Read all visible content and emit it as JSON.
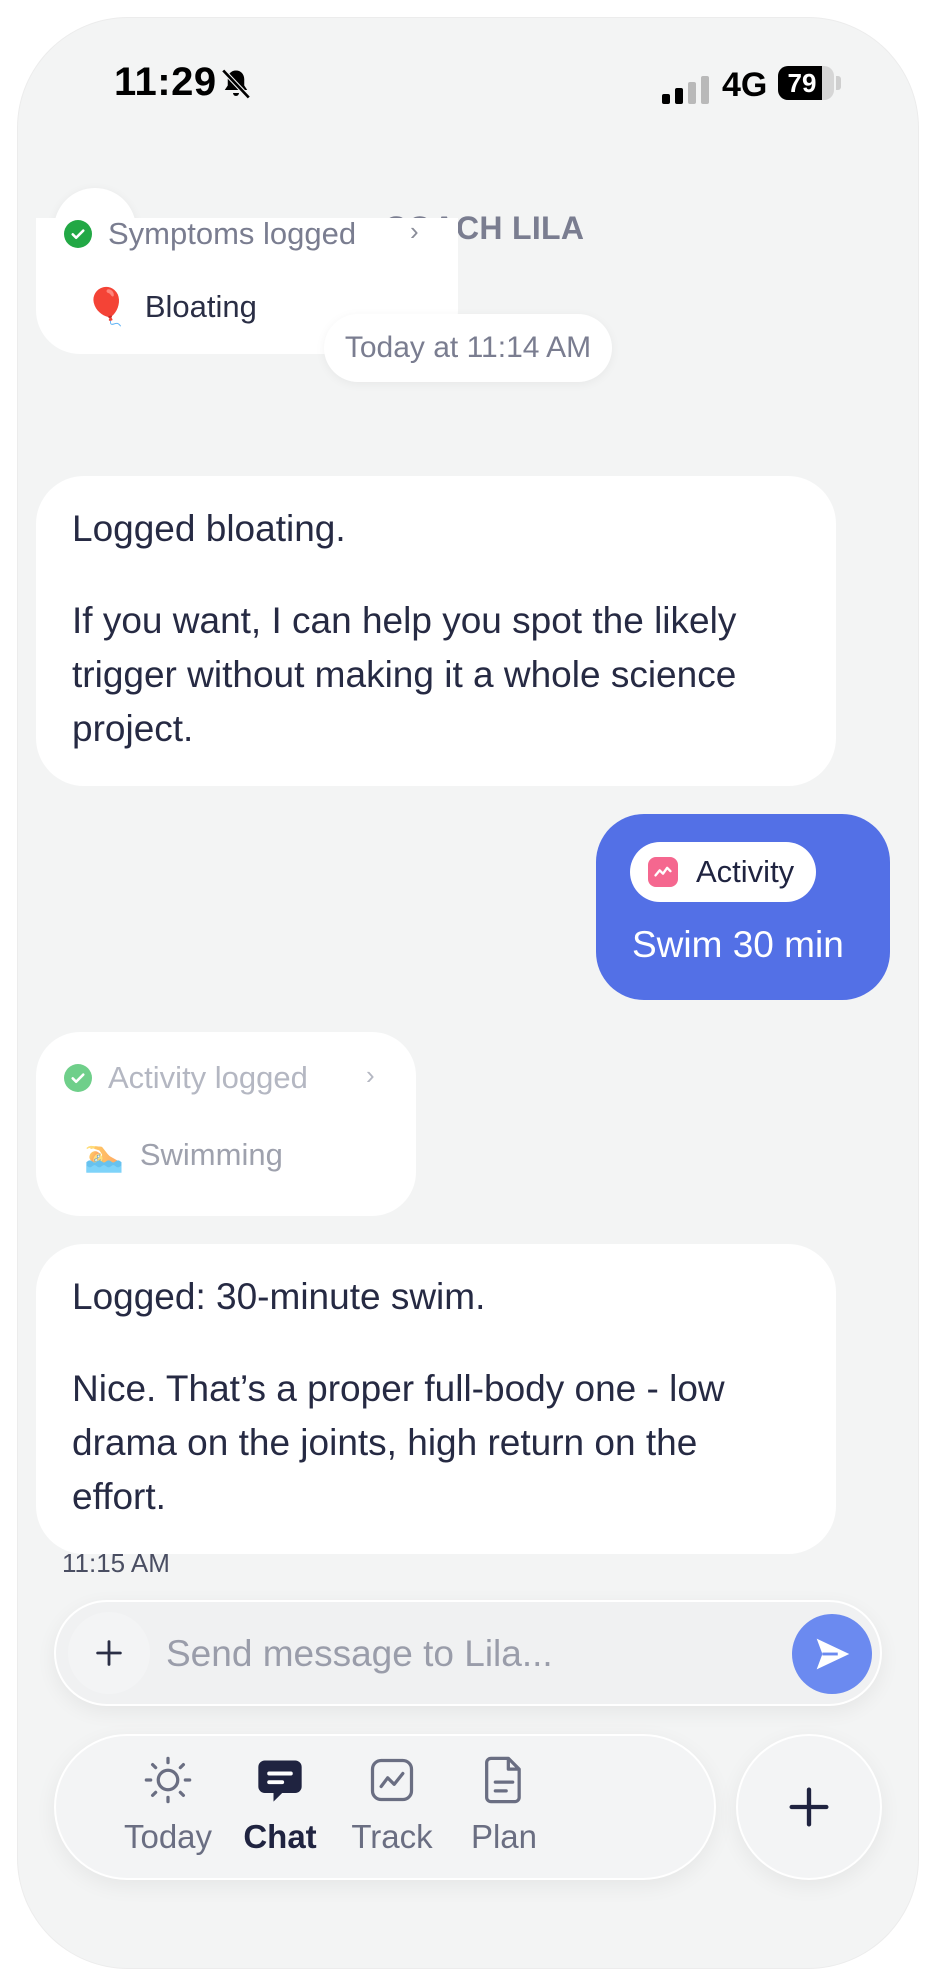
{
  "status_bar": {
    "time": "11:29",
    "network": "4G",
    "battery": "79"
  },
  "header": {
    "title": "COACH LILA"
  },
  "messages": {
    "symptoms_card": {
      "title": "Symptoms logged",
      "item": "Bloating",
      "item_emoji": "🎈"
    },
    "timestamp": "Today at 11:14 AM",
    "coach_reply_1": {
      "paragraphs": [
        "Logged bloating.",
        "If you want, I can help you spot the likely trigger without making it a whole science project."
      ]
    },
    "user_message": {
      "chip_label": "Activity",
      "text": "Swim 30 min"
    },
    "activity_card": {
      "title": "Activity logged",
      "item": "Swimming",
      "item_emoji": "🏊"
    },
    "coach_reply_2": {
      "paragraphs": [
        "Logged: 30-minute swim.",
        "Nice. That’s a proper full-body one - low drama on the joints, high return on the effort."
      ],
      "time": "11:15 AM"
    }
  },
  "composer": {
    "placeholder": "Send message to Lila..."
  },
  "tabs": [
    {
      "label": "Today",
      "icon": "sun-icon"
    },
    {
      "label": "Chat",
      "icon": "chat-icon"
    },
    {
      "label": "Track",
      "icon": "chart-icon"
    },
    {
      "label": "Plan",
      "icon": "document-icon"
    }
  ],
  "colors": {
    "accent": "#5370e6",
    "send": "#6b8af0",
    "coach_dot": "#8f86f0",
    "activity_icon": "#f5678f",
    "check_green": "#22a845"
  }
}
